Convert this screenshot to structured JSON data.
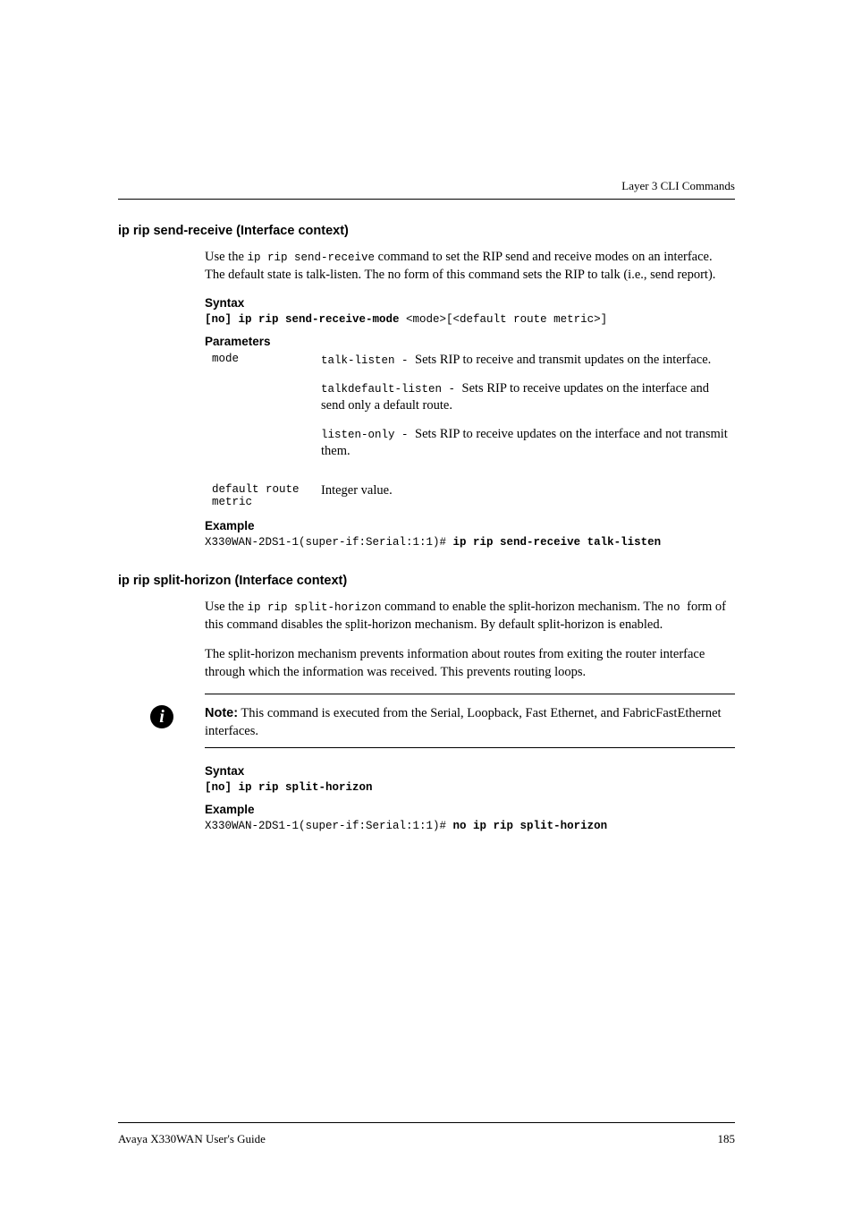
{
  "running_header": "Layer 3 CLI Commands",
  "section1": {
    "heading": "ip rip send-receive (Interface context)",
    "intro_pre": "Use the ",
    "intro_code": "ip rip send-receive",
    "intro_post": " command to set the RIP send and receive modes on an interface. The default state is talk-listen. The no form of this command sets the RIP to talk (i.e., send report).",
    "syntax_label": "Syntax",
    "syntax_bold": "[no] ip rip send-receive-mode ",
    "syntax_rest": "<mode>[<default route metric>]",
    "params_label": "Parameters",
    "param1_name": "mode",
    "param1_d1_code": "talk-listen - ",
    "param1_d1_text": "Sets RIP to receive and transmit updates on the interface.",
    "param1_d2_code": "talkdefault-listen - ",
    "param1_d2_text": "Sets RIP to receive updates on the interface and send only a default route.",
    "param1_d3_code": "listen-only - ",
    "param1_d3_text": "Sets RIP to receive updates on the interface and not transmit them.",
    "param2_name": "default route metric",
    "param2_desc": "Integer value.",
    "example_label": "Example",
    "example_pre": "X330WAN-2DS1-1(super-if:Serial:1:1)# ",
    "example_bold": "ip rip send-receive talk-listen"
  },
  "section2": {
    "heading": "ip rip split-horizon (Interface context)",
    "intro_pre": "Use the ",
    "intro_code": "ip rip split-horizon",
    "intro_mid": " command to enable the split-horizon mechanism. The ",
    "intro_code2": " no ",
    "intro_post": " form of this command disables the split-horizon mechanism. By default split-horizon is enabled.",
    "para2": "The split-horizon mechanism prevents information about routes from exiting the router interface through which the information was received. This prevents routing loops.",
    "note_label": "Note:",
    "note_text": "  This command is executed from the Serial, Loopback, Fast Ethernet, and FabricFastEthernet interfaces.",
    "syntax_label": "Syntax",
    "syntax_bold": "[no] ip rip split-horizon",
    "example_label": "Example",
    "example_pre": "X330WAN-2DS1-1(super-if:Serial:1:1)# ",
    "example_bold": "no ip rip split-horizon"
  },
  "footer": {
    "left": "Avaya X330WAN User's Guide",
    "right": "185"
  },
  "note_icon_char": "i"
}
